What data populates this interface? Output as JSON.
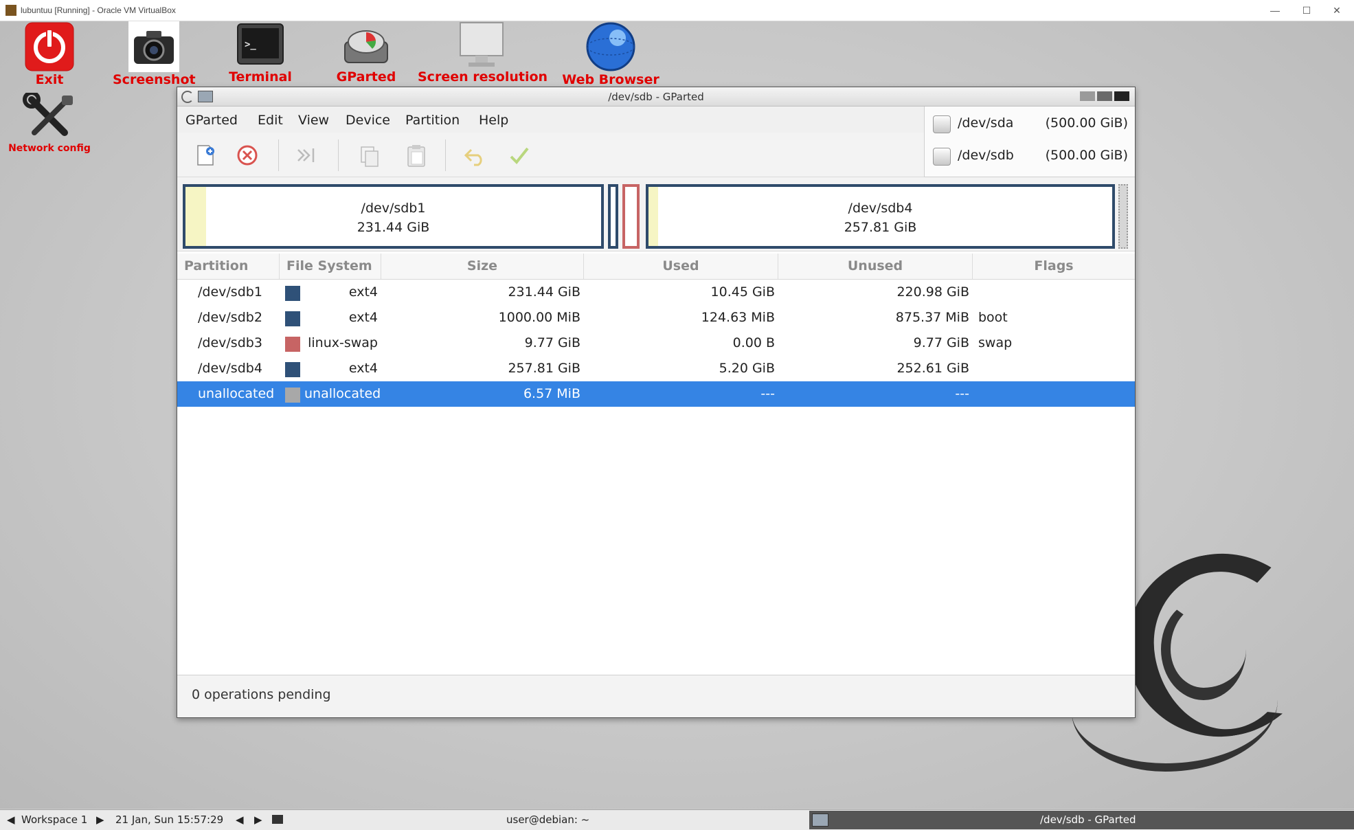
{
  "host": {
    "title": "lubuntuu [Running] - Oracle VM VirtualBox",
    "controls": [
      "—",
      "☐",
      "✕"
    ]
  },
  "desktop": {
    "icons": [
      {
        "label": "Exit",
        "icon": "power-icon"
      },
      {
        "label": "Screenshot",
        "icon": "camera-icon"
      },
      {
        "label": "Terminal",
        "icon": "terminal-icon"
      },
      {
        "label": "GParted",
        "icon": "disk-icon"
      },
      {
        "label": "Screen resolution",
        "icon": "monitor-icon"
      },
      {
        "label": "Web Browser",
        "icon": "globe-icon"
      },
      {
        "label": "Network config",
        "icon": "tools-icon"
      }
    ]
  },
  "window": {
    "title": "/dev/sdb - GParted",
    "menu": [
      "GParted",
      "Edit",
      "View",
      "Device",
      "Partition",
      "Help"
    ],
    "toolbar": [
      "new-partition-icon",
      "delete-partition-icon",
      "resize-move-icon",
      "copy-icon",
      "paste-icon",
      "undo-icon",
      "apply-icon"
    ]
  },
  "devices": [
    {
      "name": "/dev/sda",
      "size": "(500.00 GiB)"
    },
    {
      "name": "/dev/sdb",
      "size": "(500.00 GiB)"
    }
  ],
  "disk_map": {
    "sdb1": {
      "name": "/dev/sdb1",
      "size": "231.44 GiB"
    },
    "sdb4": {
      "name": "/dev/sdb4",
      "size": "257.81 GiB"
    }
  },
  "table": {
    "headers": [
      "Partition",
      "File System",
      "Size",
      "Used",
      "Unused",
      "Flags"
    ],
    "rows": [
      {
        "partition": "/dev/sdb1",
        "fs": "ext4",
        "color": "#2f5178",
        "size": "231.44 GiB",
        "used": "10.45 GiB",
        "unused": "220.98 GiB",
        "flags": ""
      },
      {
        "partition": "/dev/sdb2",
        "fs": "ext4",
        "color": "#2f5178",
        "size": "1000.00 MiB",
        "used": "124.63 MiB",
        "unused": "875.37 MiB",
        "flags": "boot"
      },
      {
        "partition": "/dev/sdb3",
        "fs": "linux-swap",
        "color": "#c76464",
        "size": "9.77 GiB",
        "used": "0.00 B",
        "unused": "9.77 GiB",
        "flags": "swap"
      },
      {
        "partition": "/dev/sdb4",
        "fs": "ext4",
        "color": "#2f5178",
        "size": "257.81 GiB",
        "used": "5.20 GiB",
        "unused": "252.61 GiB",
        "flags": ""
      },
      {
        "partition": "unallocated",
        "fs": "unallocated",
        "color": "#a8a8a8",
        "size": "6.57 MiB",
        "used": "---",
        "unused": "---",
        "flags": ""
      }
    ]
  },
  "status": {
    "text": "0 operations pending"
  },
  "taskbar": {
    "workspace": "Workspace 1",
    "clock": "21 Jan, Sun 15:57:29",
    "terminal_task": "user@debian: ~",
    "active_task": "/dev/sdb - GParted"
  }
}
